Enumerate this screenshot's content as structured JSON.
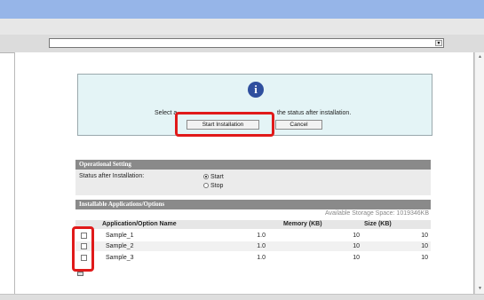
{
  "address_bar": {
    "value": ""
  },
  "message": {
    "text_left": "Select a",
    "text_right": "the status after installation.",
    "start_label": "Start Installation",
    "cancel_label": "Cancel"
  },
  "operational": {
    "title": "Operational Setting",
    "label": "Status after Installation:",
    "options": [
      {
        "label": "Start",
        "selected": true
      },
      {
        "label": "Stop",
        "selected": false
      }
    ]
  },
  "installable": {
    "title": "Installable Applications/Options",
    "storage": "Available Storage Space: 1019346KB",
    "columns": [
      "Application/Option Name",
      "Memory (KB)",
      "Size (KB)"
    ],
    "rows": [
      {
        "name": "Sample_1",
        "version": "1.0",
        "memory": "10",
        "size": "10"
      },
      {
        "name": "Sample_2",
        "version": "1.0",
        "memory": "10",
        "size": "10"
      },
      {
        "name": "Sample_3",
        "version": "1.0",
        "memory": "10",
        "size": "10"
      }
    ]
  },
  "colors": {
    "highlight": "#e01a1a",
    "title_bar": "#96b5e8",
    "message_bg": "#e4f4f6",
    "section_header": "#8a8a8a"
  }
}
